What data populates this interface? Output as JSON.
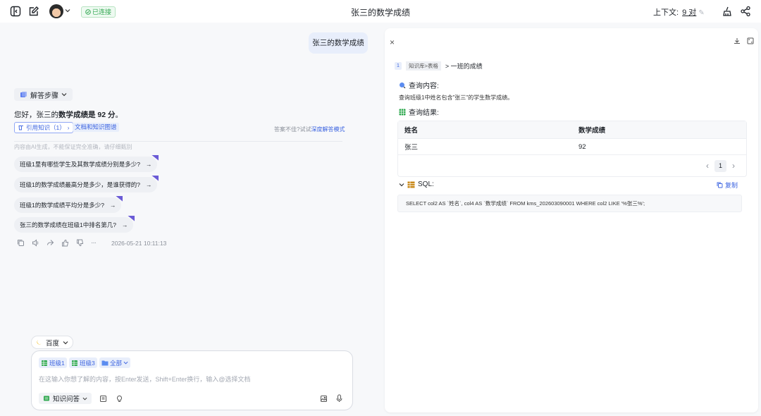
{
  "topbar": {
    "title": "张三的数学成绩",
    "status": "已连接",
    "context_label": "上下文:",
    "context_value": "9 对"
  },
  "chat": {
    "user_message": "张三的数学成绩",
    "steps_label": "解答步骤",
    "answer_prefix": "您好，张三的",
    "answer_bold": "数学成绩是 92 分",
    "answer_suffix": "。",
    "cite_label": "引用知识（1）",
    "doc_tag": "文档和知识图谱",
    "hint_prefix": "答案不佳?试试",
    "hint_link": "深度解答模式",
    "disclaimer": "内容由AI生成，不能保证完全准确，请仔细甄别",
    "followups": [
      "班级1里有哪些学生及其数学成绩分别是多少?",
      "班级1的数学成绩最高分是多少，是谁获得的?",
      "班级1的数学成绩平均分是多少?",
      "张三的数学成绩在班级1中排名第几?"
    ],
    "timestamp": "2026-05-21 10:11:13"
  },
  "input": {
    "model": "百度",
    "scopes": [
      "班级1",
      "班级3",
      "全部"
    ],
    "placeholder": "在这输入你想了解的内容，按Enter发送，Shift+Enter换行，输入@选择文档",
    "mode": "知识问答"
  },
  "panel": {
    "bc_num": "1",
    "bc_source": "知识库>表格",
    "bc_target": "> 一班的成绩",
    "query_title": "查询内容:",
    "query_text": "查询班级1中姓名包含\"张三\"的学生数学成绩。",
    "result_title": "查询结果:",
    "table": {
      "headers": [
        "姓名",
        "数学成绩"
      ],
      "rows": [
        [
          "张三",
          "92"
        ]
      ]
    },
    "page": "1",
    "sql_title": "SQL:",
    "copy_label": "复制",
    "sql": "SELECT col2 AS `姓名`, col4 AS `数学成绩` FROM kms_202603090001 WHERE col2 LIKE '%张三%';"
  }
}
